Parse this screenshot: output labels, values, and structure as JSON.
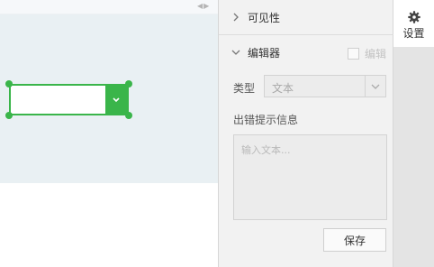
{
  "canvas": {
    "collapse_glyph": "◀▶"
  },
  "panel": {
    "visibility_section": {
      "label": "可见性"
    },
    "editor_section": {
      "label": "编辑器",
      "edit_checkbox_label": "编辑",
      "edit_checked": false,
      "type_label": "类型",
      "type_value": "文本",
      "error_msg_label": "出错提示信息",
      "error_msg_placeholder": "输入文本...",
      "save_label": "保存"
    }
  },
  "tabbar": {
    "settings_label": "设置"
  },
  "colors": {
    "accent": "#3ab54a",
    "canvas_bg": "#e9f0f3",
    "panel_bg": "#f2f2f2"
  }
}
